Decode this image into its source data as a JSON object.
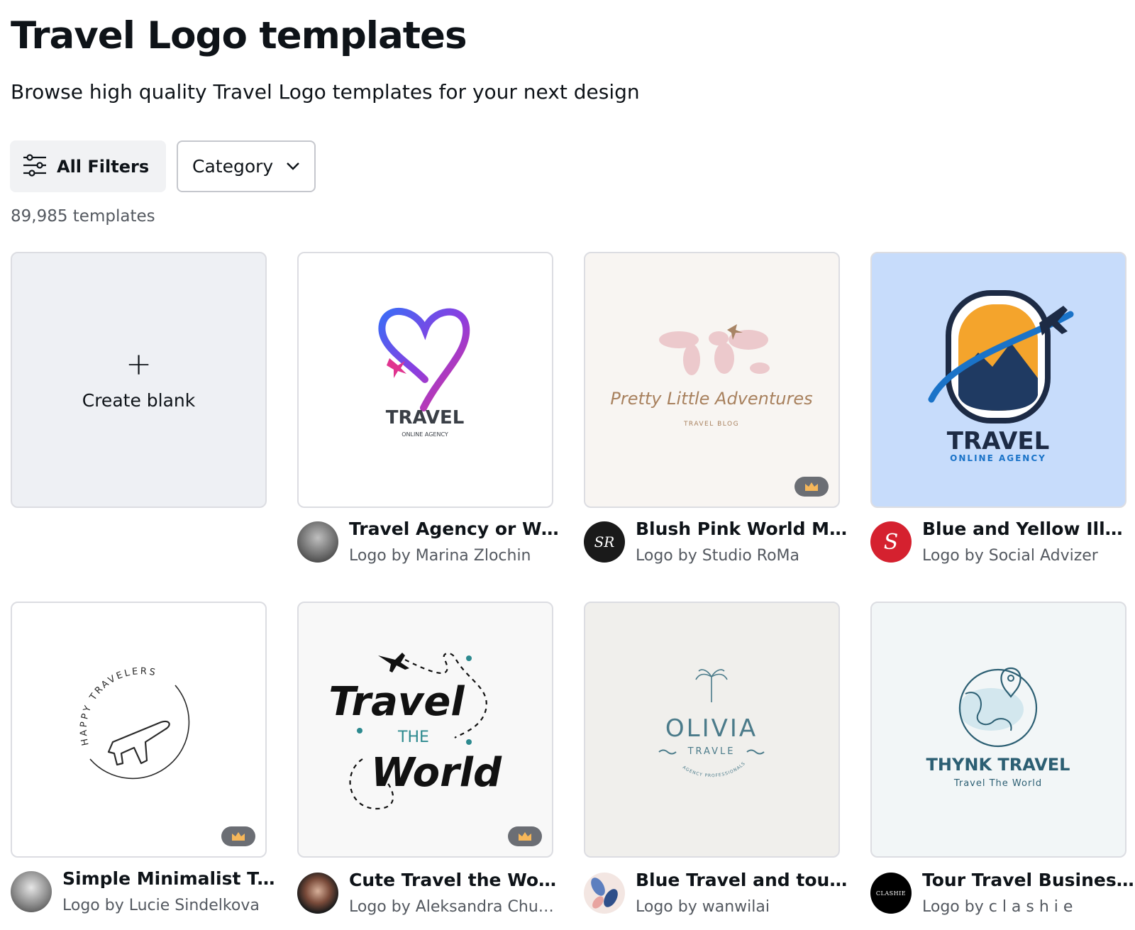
{
  "page": {
    "title": "Travel Logo templates",
    "subtitle": "Browse high quality Travel Logo templates for your next design",
    "template_count": "89,985 templates"
  },
  "filters": {
    "all_filters_label": "All Filters",
    "category_label": "Category"
  },
  "create_blank": {
    "label": "Create blank"
  },
  "templates": [
    {
      "title": "Travel Agency or Web...",
      "author": "Logo by Marina Zlochin",
      "premium": false,
      "logo": {
        "main": "TRAVEL",
        "sub": "ONLINE AGENCY"
      }
    },
    {
      "title": "Blush Pink World Ma...",
      "author": "Logo by Studio RoMa",
      "premium": true,
      "logo": {
        "main": "Pretty Little Adventures",
        "sub": "TRAVEL BLOG"
      }
    },
    {
      "title": "Blue and Yellow Illust...",
      "author": "Logo by Social Advizer",
      "premium": false,
      "logo": {
        "main": "TRAVEL",
        "sub": "ONLINE AGENCY"
      }
    },
    {
      "title": "Simple Minimalist Tra...",
      "author": "Logo by Lucie Sindelkova",
      "premium": true,
      "logo": {
        "main": "HAPPY TRAVELERS"
      }
    },
    {
      "title": "Cute Travel the Worl...",
      "author": "Logo by Aleksandra Chub...",
      "premium": true,
      "logo": {
        "line1": "Travel",
        "line2": "THE",
        "line3": "World"
      }
    },
    {
      "title": "Blue Travel and touri...",
      "author": "Logo by wanwilai",
      "premium": false,
      "logo": {
        "main": "OLIVIA",
        "sub": "TRAVLE",
        "arc": "AGENCY PROFESSIONALS"
      }
    },
    {
      "title": "Tour Travel Business ...",
      "author": "Logo by c l a s h i e",
      "premium": false,
      "logo": {
        "main": "THYNK TRAVEL",
        "sub": "Travel The World"
      }
    }
  ],
  "avatars": {
    "studio_roma": "SR",
    "social_advizer": "S",
    "clashie": "CLASHIE"
  },
  "colors": {
    "canva_crown": "#f6b75a",
    "blank_bg": "#eef0f4",
    "blue_card_bg": "#c7dcfb"
  }
}
